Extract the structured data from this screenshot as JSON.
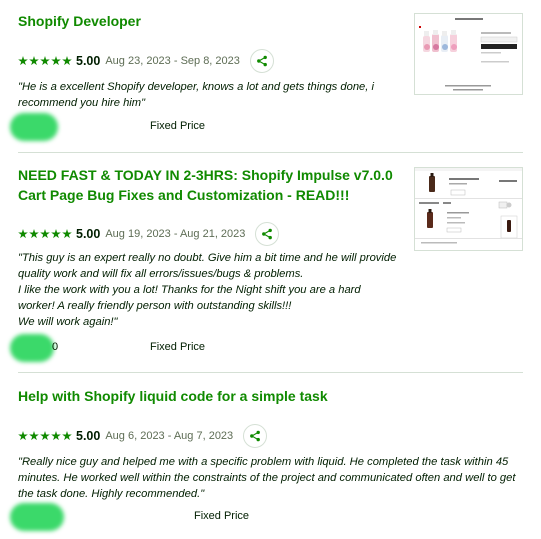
{
  "jobs": [
    {
      "title": "Shopify Developer",
      "score": "5.00",
      "dates": "Aug 23, 2023 - Sep 8, 2023",
      "feedback_lines": [
        "\"He is a excellent Shopify developer, knows a lot and gets things done, i recommend you hire him\""
      ],
      "earned_tail": "",
      "price_type": "Fixed Price",
      "thumbnail_icon": "product-page-thumbnail"
    },
    {
      "title": "NEED FAST & TODAY IN 2-3HRS: Shopify Impulse v7.0.0 Cart Page Bug Fixes and Customization - READ!!!",
      "score": "5.00",
      "dates": "Aug 19, 2023 - Aug 21, 2023",
      "feedback_lines": [
        "\"This guy is an expert really no doubt. Give him a bit time and he will provide quality work and will fix all errors/issues/bugs & problems.",
        "I like the work with you a lot! Thanks for the Night shift you are a hard worker! A really friendly person with outstanding skills!!!",
        "We will work again!\""
      ],
      "earned_tail": "0",
      "price_type": "Fixed Price",
      "thumbnail_icon": "cart-page-thumbnail"
    },
    {
      "title": "Help with Shopify liquid code for a simple task",
      "score": "5.00",
      "dates": "Aug 6, 2023 - Aug 7, 2023",
      "feedback_lines": [
        "\"Really nice guy and helped me with a specific problem with liquid. He completed the task within 45 minutes. He worked well within the constraints of the project and communicated often and well to get the task done. Highly recommended.\""
      ],
      "earned_tail": "",
      "price_type": "Fixed Price"
    }
  ],
  "colors": {
    "accent": "#108a00",
    "text": "#001e00",
    "muted": "#5e6d55",
    "border": "#d5e0d5",
    "redaction": "#3bd96a"
  }
}
